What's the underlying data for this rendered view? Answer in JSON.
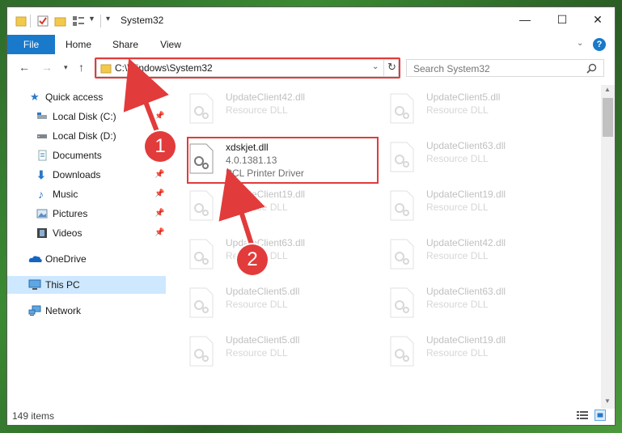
{
  "window": {
    "title": "System32"
  },
  "window_controls": {
    "minimize": "—",
    "maximize": "☐",
    "close": "✕"
  },
  "ribbon": {
    "tabs": [
      {
        "label": "File"
      },
      {
        "label": "Home"
      },
      {
        "label": "Share"
      },
      {
        "label": "View"
      }
    ],
    "help": "?"
  },
  "address_bar": {
    "path": "C:\\Windows\\System32"
  },
  "search": {
    "placeholder": "Search System32"
  },
  "sidebar": {
    "items": [
      {
        "label": "Quick access",
        "icon": "star-icon",
        "pinned": false
      },
      {
        "label": "Local Disk (C:)",
        "icon": "drive-icon",
        "pinned": true
      },
      {
        "label": "Local Disk (D:)",
        "icon": "drive-icon",
        "pinned": false
      },
      {
        "label": "Documents",
        "icon": "documents-icon",
        "pinned": true
      },
      {
        "label": "Downloads",
        "icon": "downloads-icon",
        "pinned": true
      },
      {
        "label": "Music",
        "icon": "music-icon",
        "pinned": true
      },
      {
        "label": "Pictures",
        "icon": "pictures-icon",
        "pinned": true
      },
      {
        "label": "Videos",
        "icon": "videos-icon",
        "pinned": true
      },
      {
        "label": "OneDrive",
        "icon": "cloud-icon",
        "pinned": false
      },
      {
        "label": "This PC",
        "icon": "computer-icon",
        "pinned": false,
        "selected": true
      },
      {
        "label": "Network",
        "icon": "network-icon",
        "pinned": false
      }
    ]
  },
  "files": {
    "col1": [
      {
        "name": "UpdateClient42.dll",
        "desc": "Resource DLL",
        "faded": true
      },
      {
        "name": "xdskjet.dll",
        "version": "4.0.1381.13",
        "desc": "PCL Printer Driver",
        "faded": false
      },
      {
        "name": "UpdateClient19.dll",
        "desc": "Resource DLL",
        "faded": true
      },
      {
        "name": "UpdateClient63.dll",
        "desc": "Resource DLL",
        "faded": true
      },
      {
        "name": "UpdateClient5.dll",
        "desc": "Resource DLL",
        "faded": true
      },
      {
        "name": "UpdateClient5.dll",
        "desc": "Resource DLL",
        "faded": true
      }
    ],
    "col2": [
      {
        "name": "UpdateClient5.dll",
        "desc": "Resource DLL",
        "faded": true
      },
      {
        "name": "UpdateClient63.dll",
        "desc": "Resource DLL",
        "faded": true
      },
      {
        "name": "UpdateClient19.dll",
        "desc": "Resource DLL",
        "faded": true
      },
      {
        "name": "UpdateClient42.dll",
        "desc": "Resource DLL",
        "faded": true
      },
      {
        "name": "UpdateClient63.dll",
        "desc": "Resource DLL",
        "faded": true
      },
      {
        "name": "UpdateClient19.dll",
        "desc": "Resource DLL",
        "faded": true
      }
    ]
  },
  "status": {
    "count": "149 items"
  },
  "annotations": {
    "step1": "1",
    "step2": "2"
  },
  "colors": {
    "accent": "#1979ca",
    "highlight": "#e23b3b",
    "selected": "#cde8ff"
  }
}
